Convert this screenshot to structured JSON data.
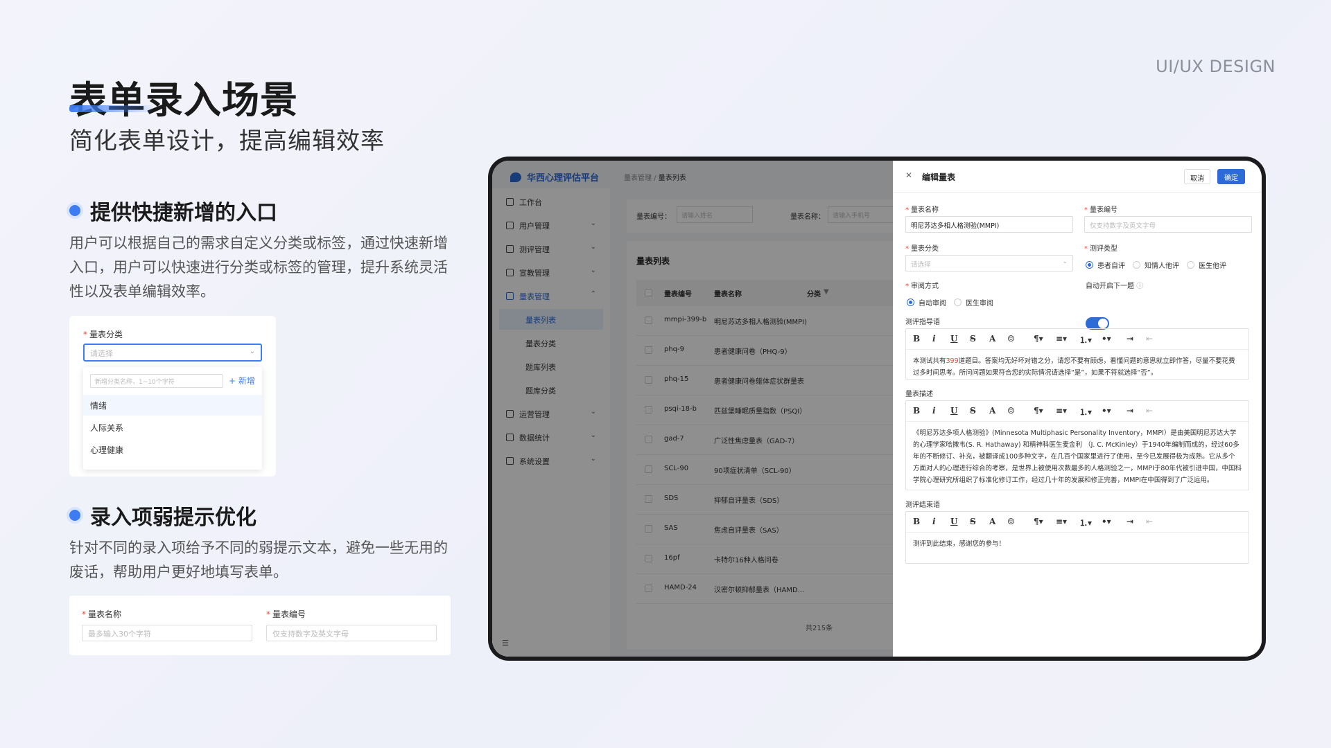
{
  "brand": "UI/UX DESIGN",
  "title": "表单录入场景",
  "subtitle": "简化表单设计，提高编辑效率",
  "sections": [
    {
      "heading": "提供快捷新增的入口",
      "text": "用户可以根据自己的需求自定义分类或标签，通过快速新增入口，用户可以快速进行分类或标签的管理，提升系统灵活性以及表单编辑效率。"
    },
    {
      "heading": "录入项弱提示优化",
      "text": "针对不同的录入项给予不同的弱提示文本，避免一些无用的废话，帮助用户更好地填写表单。"
    }
  ],
  "demo_category": {
    "label": "量表分类",
    "select_placeholder": "请选择",
    "new_input_placeholder": "新增分类名称，1~10个字符",
    "add_label": "+ 新增",
    "options": [
      "情绪",
      "人际关系",
      "心理健康"
    ]
  },
  "demo_hints": {
    "name_label": "量表名称",
    "name_placeholder": "最多输入30个字符",
    "code_label": "量表编号",
    "code_placeholder": "仅支持数字及英文字母"
  },
  "app": {
    "logo": "华西心理评估平台",
    "breadcrumb_parent": "量表管理",
    "breadcrumb_sep": "/",
    "breadcrumb_current": "量表列表",
    "nav": [
      {
        "label": "工作台",
        "icon": "monitor-icon"
      },
      {
        "label": "用户管理",
        "icon": "user-icon"
      },
      {
        "label": "测评管理",
        "icon": "clipboard-icon"
      },
      {
        "label": "宣教管理",
        "icon": "book-icon"
      },
      {
        "label": "量表管理",
        "icon": "form-icon"
      },
      {
        "label": "量表列表",
        "icon": ""
      },
      {
        "label": "量表分类",
        "icon": ""
      },
      {
        "label": "题库列表",
        "icon": ""
      },
      {
        "label": "题库分类",
        "icon": ""
      },
      {
        "label": "运营管理",
        "icon": "operation-icon"
      },
      {
        "label": "数据统计",
        "icon": "chart-icon"
      },
      {
        "label": "系统设置",
        "icon": "gear-icon"
      }
    ],
    "filter": {
      "code_label": "量表编号：",
      "code_placeholder": "请输入姓名",
      "name_label": "量表名称：",
      "name_placeholder": "请输入手机号"
    },
    "table": {
      "title": "量表列表",
      "columns": [
        "量表编号",
        "量表名称",
        "分类"
      ],
      "rows": [
        {
          "code": "mmpi-399-b",
          "name": "明尼苏达多相人格测验(MMPI)"
        },
        {
          "code": "phq-9",
          "name": "患者健康问卷（PHQ-9）"
        },
        {
          "code": "phq-15",
          "name": "患者健康问卷躯体症状群量表"
        },
        {
          "code": "psqi-18-b",
          "name": "匹兹堡睡眠质量指数（PSQI）"
        },
        {
          "code": "gad-7",
          "name": "广泛性焦虑量表（GAD-7）"
        },
        {
          "code": "SCL-90",
          "name": "90项症状清单（SCL-90）"
        },
        {
          "code": "SDS",
          "name": "抑郁自评量表（SDS）"
        },
        {
          "code": "SAS",
          "name": "焦虑自评量表（SAS）"
        },
        {
          "code": "16pf",
          "name": "卡特尔16种人格问卷"
        },
        {
          "code": "HAMD-24",
          "name": "汉密尔顿抑郁量表（HAMD..."
        }
      ],
      "total": "共215条"
    }
  },
  "panel": {
    "title": "编辑量表",
    "cancel": "取消",
    "confirm": "确定",
    "name_label": "量表名称",
    "name_value": "明尼苏达多相人格测验(MMPI)",
    "code_label": "量表编号",
    "code_placeholder": "仅支持数字及英文字母",
    "category_label": "量表分类",
    "category_placeholder": "请选择",
    "type_label": "测评类型",
    "type_options": [
      "患者自评",
      "知情人他评",
      "医生他评"
    ],
    "review_label": "审阅方式",
    "review_options": [
      "自动审阅",
      "医生审阅"
    ],
    "auto_next_label": "自动开启下一题",
    "guide_label": "测评指导语",
    "guide_text_a": "本测试共有",
    "guide_text_num": "399",
    "guide_text_b": "道题目。答案均无好坏对错之分，请您不要有顾虑，看懂问题的意思就立即作答，尽量不要花费过多时间思考。所问问题如果符合您的实际情况请选择“是”，如果不符就选择“否”。",
    "desc_label": "量表描述",
    "desc_text": "《明尼苏达多项人格测验》(Minnesota Multiphasic Personality Inventory，MMPI）是由美国明尼苏达大学的心理学家哈撒韦(S. R. Hathaway) 和精神科医生麦金利 （J. C. McKinley）于1940年编制而成的，经过60多年的不断修订、补充，被翻译成100多种文字，在几百个国家里进行了使用，至今已发展得极为成熟。它从多个方面对人的心理进行综合的考察，是世界上被使用次数最多的人格测验之一，MMPI于80年代被引进中国，中国科学院心理研究所组织了标准化修订工作，经过几十年的发展和修正完善，MMPI在中国得到了广泛运用。",
    "end_label": "测评结束语",
    "end_text": "测评到此结束，感谢您的参与！",
    "toolbar": [
      "B",
      "i",
      "U",
      "S",
      "A",
      "☺",
      "¶▾",
      "≡▾",
      "⒈▾",
      "•▾",
      "⇥",
      "⇤"
    ]
  }
}
